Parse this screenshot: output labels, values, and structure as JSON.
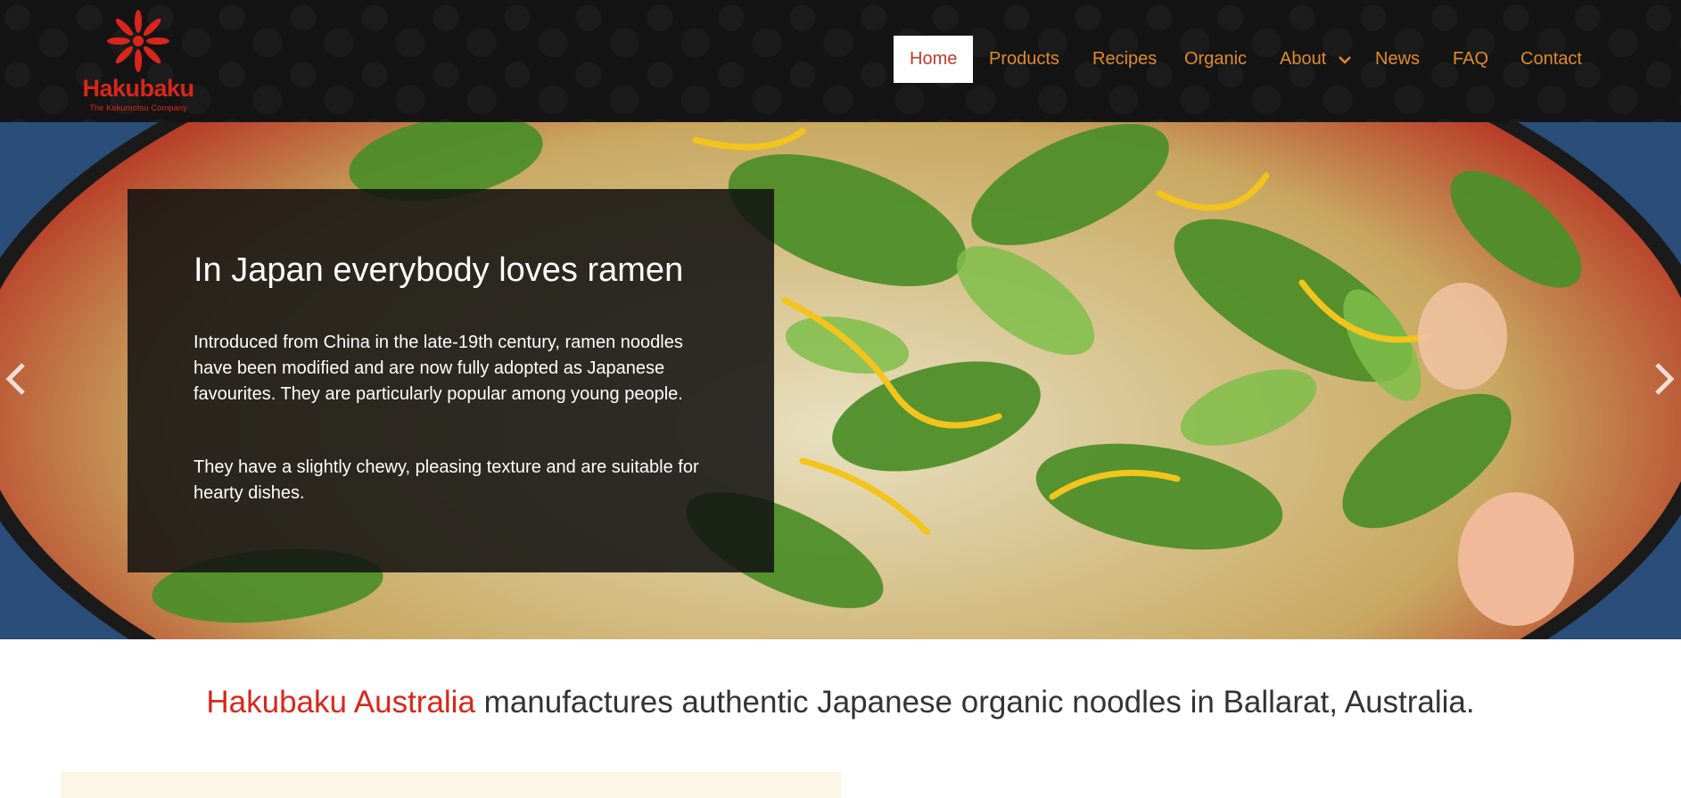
{
  "brand": {
    "name": "Hakubaku",
    "tagline": "The Kokumotsu Company",
    "color": "#d9261c"
  },
  "nav": {
    "items": [
      {
        "label": "Home",
        "active": true
      },
      {
        "label": "Products"
      },
      {
        "label": "Recipes"
      },
      {
        "label": "Organic"
      },
      {
        "label": "About",
        "has_dropdown": true
      },
      {
        "label": "News"
      },
      {
        "label": "FAQ"
      },
      {
        "label": "Contact"
      }
    ],
    "text_color": "#e08a2a"
  },
  "hero": {
    "heading": "In Japan everybody loves ramen",
    "paragraphs": [
      "Introduced from China in the late-19th century, ramen noodles have been modified and are now fully adopted as Japanese favourites. They are particularly popular among young people.",
      "They have a slightly chewy, pleasing texture and are suitable for hearty dishes."
    ],
    "prev_icon": "chevron-left-icon",
    "next_icon": "chevron-right-icon"
  },
  "intro": {
    "brand": "Hakubaku Australia",
    "text": " manufactures authentic Japanese organic noodles in Ballarat, Australia."
  }
}
